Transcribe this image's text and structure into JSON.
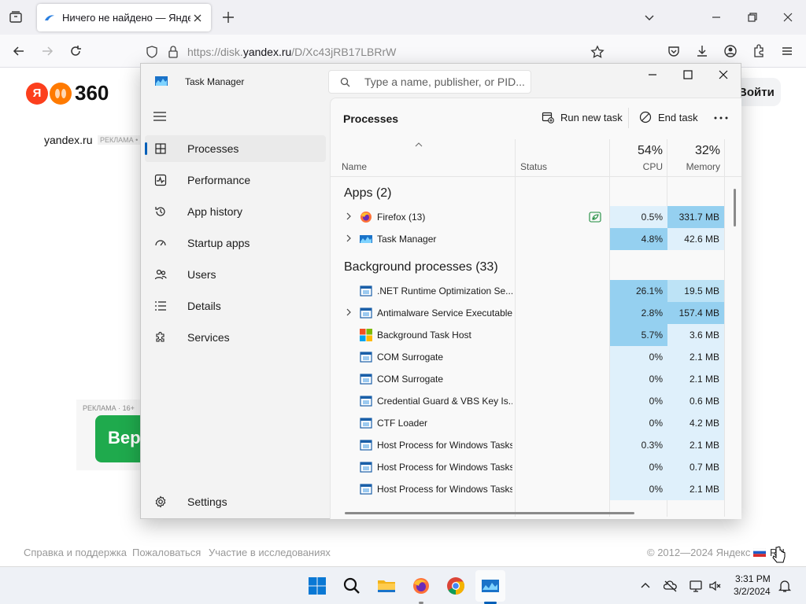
{
  "browser": {
    "tab_title": "Ничего не найдено — Яндекс",
    "url_prefix": "https://disk.",
    "url_host": "yandex.ru",
    "url_path": "/D/Xc43jRB17LBRrW"
  },
  "page": {
    "logo_text": "360",
    "logo_ya": "Я",
    "site_link": "yandex.ru",
    "ad_small": "РЕКЛАМА • С",
    "login": "Войти",
    "ad_label": "РЕКЛАМА · 16+",
    "ad_button": "Вер",
    "footer": {
      "help": "Справка и поддержка",
      "complain": "Пожаловаться",
      "research": "Участие в исследованиях",
      "copyright": "© 2012—2024 Яндекс",
      "lang": "RU"
    }
  },
  "taskmanager": {
    "title": "Task Manager",
    "search_placeholder": "Type a name, publisher, or PID...",
    "nav": {
      "processes": "Processes",
      "performance": "Performance",
      "app_history": "App history",
      "startup": "Startup apps",
      "users": "Users",
      "details": "Details",
      "services": "Services",
      "settings": "Settings"
    },
    "header": "Processes",
    "run_new_task": "Run new task",
    "end_task": "End task",
    "columns": {
      "name": "Name",
      "status": "Status",
      "cpu_pct": "54%",
      "cpu": "CPU",
      "mem_pct": "32%",
      "memory": "Memory"
    },
    "groups": {
      "apps": "Apps (2)",
      "background": "Background processes (33)"
    },
    "apps": [
      {
        "name": "Firefox (13)",
        "cpu": "0.5%",
        "mem": "331.7 MB",
        "icon": "firefox-icon"
      },
      {
        "name": "Task Manager",
        "cpu": "4.8%",
        "mem": "42.6 MB",
        "icon": "taskmanager-icon"
      }
    ],
    "background": [
      {
        "name": ".NET Runtime Optimization Se...",
        "cpu": "26.1%",
        "mem": "19.5 MB"
      },
      {
        "name": "Antimalware Service Executable",
        "cpu": "2.8%",
        "mem": "157.4 MB"
      },
      {
        "name": "Background Task Host",
        "cpu": "5.7%",
        "mem": "3.6 MB"
      },
      {
        "name": "COM Surrogate",
        "cpu": "0%",
        "mem": "2.1 MB"
      },
      {
        "name": "COM Surrogate",
        "cpu": "0%",
        "mem": "2.1 MB"
      },
      {
        "name": "Credential Guard & VBS Key Is...",
        "cpu": "0%",
        "mem": "0.6 MB"
      },
      {
        "name": "CTF Loader",
        "cpu": "0%",
        "mem": "4.2 MB"
      },
      {
        "name": "Host Process for Windows Tasks",
        "cpu": "0.3%",
        "mem": "2.1 MB"
      },
      {
        "name": "Host Process for Windows Tasks",
        "cpu": "0%",
        "mem": "0.7 MB"
      },
      {
        "name": "Host Process for Windows Tasks",
        "cpu": "0%",
        "mem": "2.1 MB"
      }
    ]
  },
  "taskbar": {
    "time": "3:31 PM",
    "date": "3/2/2024"
  },
  "colors": {
    "accent": "#005fb8",
    "heat_low": "#dff0fb",
    "heat_mid": "#bde3f6",
    "heat_high": "#95d0f0"
  }
}
